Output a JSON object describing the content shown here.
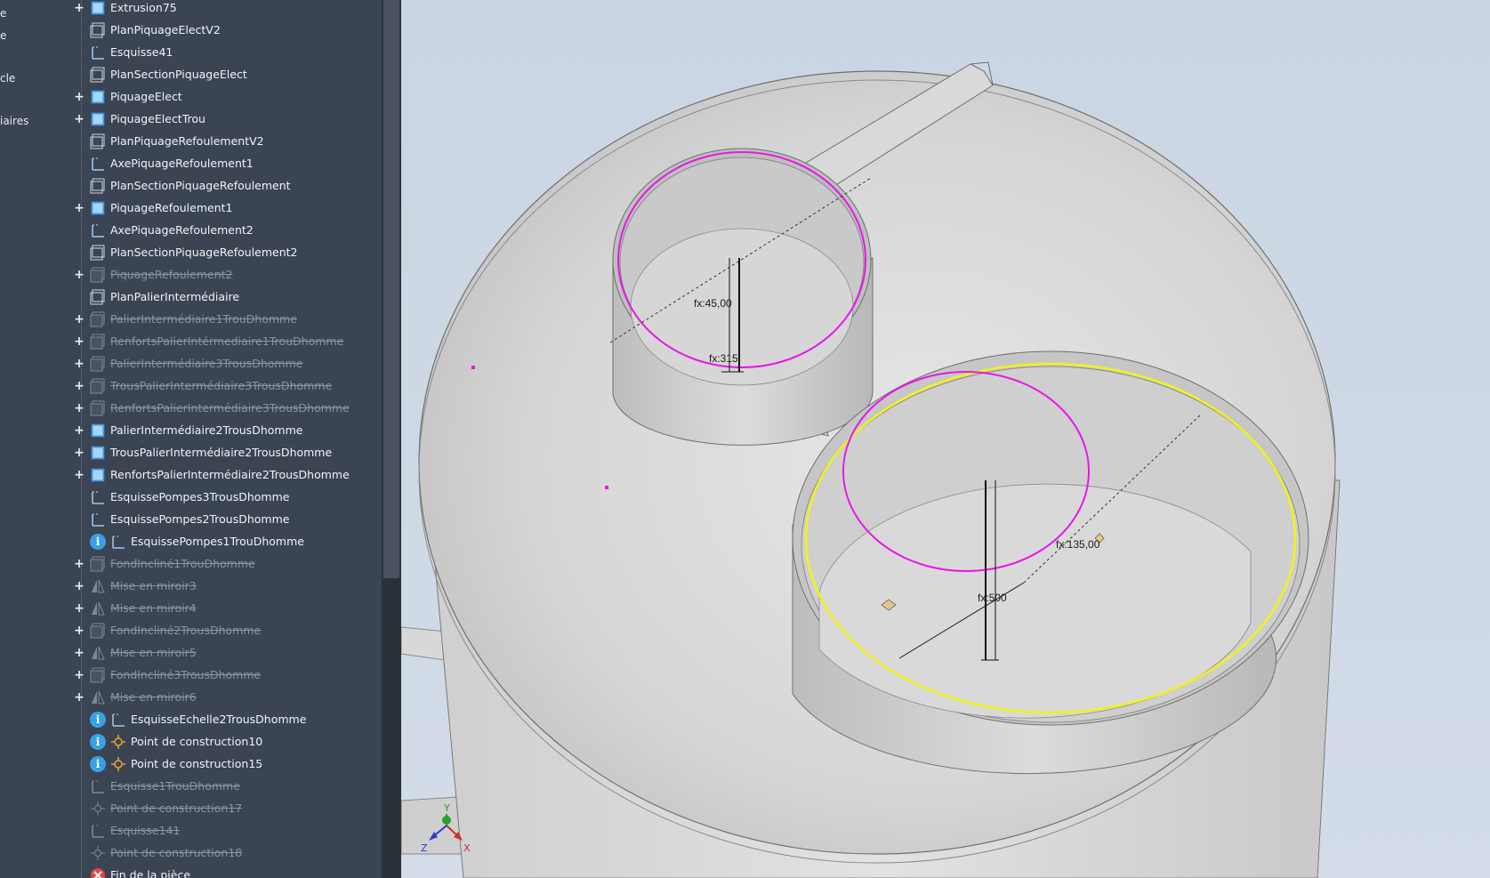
{
  "left_strip": {
    "items": [
      "e",
      "e",
      "cle",
      "iaires"
    ]
  },
  "browser": {
    "nodes": [
      {
        "label": "Extrusion75",
        "icon": "extrusion-icon",
        "expandable": true,
        "suppressed": false
      },
      {
        "label": "PlanPiquageElectV2",
        "icon": "work-plane-icon",
        "expandable": false,
        "suppressed": false
      },
      {
        "label": "Esquisse41",
        "icon": "sketch-icon",
        "expandable": false,
        "suppressed": false
      },
      {
        "label": "PlanSectionPiquageElect",
        "icon": "work-plane-icon",
        "expandable": false,
        "suppressed": false
      },
      {
        "label": "PiquageElect",
        "icon": "extrusion-icon",
        "expandable": true,
        "suppressed": false
      },
      {
        "label": "PiquageElectTrou",
        "icon": "extrusion-icon",
        "expandable": true,
        "suppressed": false
      },
      {
        "label": "PlanPiquageRefoulementV2",
        "icon": "work-plane-icon",
        "expandable": false,
        "suppressed": false
      },
      {
        "label": "AxePiquageRefoulement1",
        "icon": "sketch-icon",
        "expandable": false,
        "suppressed": false
      },
      {
        "label": "PlanSectionPiquageRefoulement",
        "icon": "work-plane-icon",
        "expandable": false,
        "suppressed": false
      },
      {
        "label": "PiquageRefoulement1",
        "icon": "extrusion-icon",
        "expandable": true,
        "suppressed": false
      },
      {
        "label": "AxePiquageRefoulement2",
        "icon": "sketch-icon",
        "expandable": false,
        "suppressed": false
      },
      {
        "label": "PlanSectionPiquageRefoulement2",
        "icon": "work-plane-icon",
        "expandable": false,
        "suppressed": false
      },
      {
        "label": "PiquageRefoulement2",
        "icon": "extrusion-icon",
        "expandable": true,
        "suppressed": true
      },
      {
        "label": "PlanPalierIntermédiaire",
        "icon": "work-plane-icon",
        "expandable": false,
        "suppressed": false
      },
      {
        "label": "PalierIntermédiaire1TrouDhomme",
        "icon": "extrusion-icon",
        "expandable": true,
        "suppressed": true
      },
      {
        "label": "RenfortsPalierIntérmediaire1TrouDhomme",
        "icon": "extrusion-icon",
        "expandable": true,
        "suppressed": true
      },
      {
        "label": "PalierIntermédiaire3TrousDhomme",
        "icon": "extrusion-icon",
        "expandable": true,
        "suppressed": true
      },
      {
        "label": "TrousPalierIntermédiaire3TrousDhomme",
        "icon": "extrusion-icon",
        "expandable": true,
        "suppressed": true
      },
      {
        "label": "RenfortsPalierIntermédiaire3TrousDhomme",
        "icon": "extrusion-icon",
        "expandable": true,
        "suppressed": true
      },
      {
        "label": "PalierIntermédiaire2TrousDhomme",
        "icon": "extrusion-icon",
        "expandable": true,
        "suppressed": false
      },
      {
        "label": "TrousPalierIntermédiaire2TrousDhomme",
        "icon": "extrusion-icon",
        "expandable": true,
        "suppressed": false
      },
      {
        "label": "RenfortsPalierIntermédiaire2TrousDhomme",
        "icon": "extrusion-icon",
        "expandable": true,
        "suppressed": false
      },
      {
        "label": "EsquissePompes3TrousDhomme",
        "icon": "sketch-icon",
        "expandable": false,
        "suppressed": false
      },
      {
        "label": "EsquissePompes2TrousDhomme",
        "icon": "sketch-icon",
        "expandable": false,
        "suppressed": false
      },
      {
        "label": "EsquissePompes1TrouDhomme",
        "icon": "sketch-icon",
        "expandable": false,
        "suppressed": false,
        "info": true
      },
      {
        "label": "FondIncliné1TrouDhomme",
        "icon": "extrusion-icon",
        "expandable": true,
        "suppressed": true
      },
      {
        "label": "Mise en miroir3",
        "icon": "mirror-icon",
        "expandable": true,
        "suppressed": true
      },
      {
        "label": "Mise en miroir4",
        "icon": "mirror-icon",
        "expandable": true,
        "suppressed": true
      },
      {
        "label": "FondIncliné2TrousDhomme",
        "icon": "extrusion-icon",
        "expandable": true,
        "suppressed": true
      },
      {
        "label": "Mise en miroir5",
        "icon": "mirror-icon",
        "expandable": true,
        "suppressed": true
      },
      {
        "label": "FondIncliné3TrousDhomme",
        "icon": "extrusion-icon",
        "expandable": true,
        "suppressed": true
      },
      {
        "label": "Mise en miroir6",
        "icon": "mirror-icon",
        "expandable": true,
        "suppressed": true
      },
      {
        "label": "EsquisseEchelle2TrousDhomme",
        "icon": "sketch-icon",
        "expandable": false,
        "suppressed": false,
        "info": true
      },
      {
        "label": "Point de construction10",
        "icon": "work-point-icon",
        "expandable": false,
        "suppressed": false,
        "info": true
      },
      {
        "label": "Point de construction15",
        "icon": "work-point-icon",
        "expandable": false,
        "suppressed": false,
        "info": true
      },
      {
        "label": "Esquisse1TrouDhomme",
        "icon": "sketch-icon",
        "expandable": false,
        "suppressed": true
      },
      {
        "label": "Point de construction17",
        "icon": "work-point-icon",
        "expandable": false,
        "suppressed": true
      },
      {
        "label": "Esquisse141",
        "icon": "sketch-icon",
        "expandable": false,
        "suppressed": true
      },
      {
        "label": "Point de construction18",
        "icon": "work-point-icon",
        "expandable": false,
        "suppressed": true
      },
      {
        "label": "Fin de la pièce",
        "icon": "end-of-part-icon",
        "expandable": false,
        "suppressed": false
      }
    ]
  },
  "viewport": {
    "dimensions": {
      "upper_angle": "fx:45,00",
      "upper_length": "fx:315",
      "lower_angle": "fx:135,00",
      "lower_length": "fx:500"
    },
    "axes": {
      "x": "X",
      "y": "Y",
      "z": "Z"
    },
    "colors": {
      "sketch_magenta": "#e619e6",
      "selection_yellow": "#f2f21a",
      "part_grey": "#d9d9d9"
    }
  }
}
